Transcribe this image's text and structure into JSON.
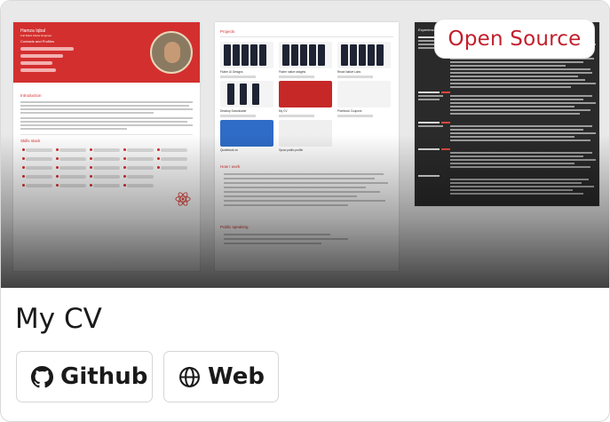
{
  "badge": {
    "label": "Open Source"
  },
  "card": {
    "title": "My CV"
  },
  "links": [
    {
      "label": "Github",
      "icon": "github-icon"
    },
    {
      "label": "Web",
      "icon": "globe-icon"
    }
  ],
  "preview": {
    "cv": {
      "name": "Hamza Iqbal",
      "role": "Full Stack Flutter Engineer",
      "contact_title": "Contacts and Profiles",
      "intro_title": "Introduction",
      "skills_title": "Skills stack"
    },
    "projects": {
      "title": "Projects",
      "items": [
        "Flutter UI Designs",
        "Flutter native widgets",
        "React Native Labs",
        "Desktop Downloader",
        "My CV",
        "Pixelbook Coupons",
        "Quotebook on",
        "Gpow public profile"
      ],
      "how_title": "How I work",
      "speaking_title": "Public speaking"
    },
    "dark": {
      "title": "Experience"
    }
  },
  "colors": {
    "accent": "#c21f2b",
    "cv_header": "#d32f2f",
    "text": "#1a1a1a",
    "border": "#d6d6d6"
  }
}
